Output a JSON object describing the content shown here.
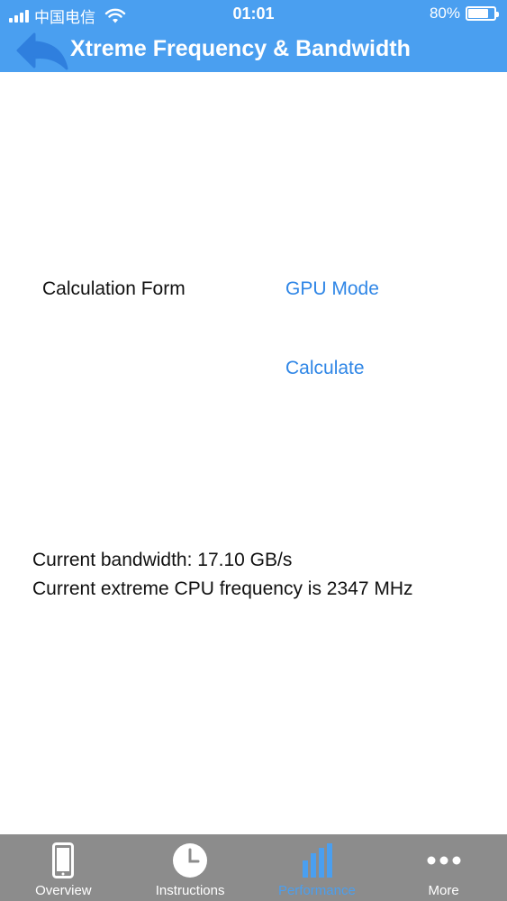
{
  "status_bar": {
    "carrier": "中国电信",
    "time": "01:01",
    "battery_percent": "80%",
    "battery_level": 0.8
  },
  "nav": {
    "title": "Xtreme Frequency & Bandwidth",
    "back_icon": "back-arrow-icon"
  },
  "form": {
    "calculation_label": "Calculation Form",
    "mode_link": "GPU Mode",
    "calculate_link": "Calculate"
  },
  "results": {
    "bandwidth": "Current bandwidth: 17.10 GB/s",
    "cpu_frequency": "Current extreme CPU frequency is 2347 MHz"
  },
  "tabs": [
    {
      "label": "Overview",
      "icon": "phone-icon",
      "active": false
    },
    {
      "label": "Instructions",
      "icon": "clock-icon",
      "active": false
    },
    {
      "label": "Performance",
      "icon": "bar-chart-icon",
      "active": true
    },
    {
      "label": "More",
      "icon": "more-dots-icon",
      "active": false
    }
  ],
  "colors": {
    "header": "#4a9ff0",
    "link": "#2f86e6",
    "tab_bar": "#8c8c8c",
    "tab_active": "#4a9ff0"
  }
}
